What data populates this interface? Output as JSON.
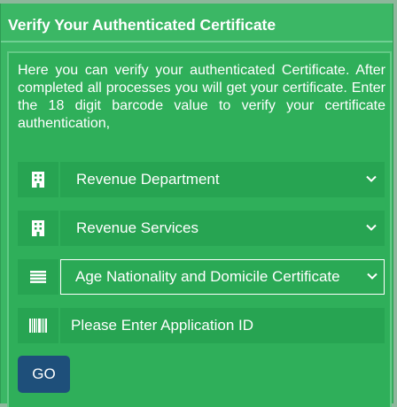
{
  "panel": {
    "title": "Verify Your Authenticated Certificate"
  },
  "intro_text": "Here you can verify your authenticated Certificate. After completed all processes you will get your certificate. Enter the 18 digit barcode value to verify your certificate authentication,",
  "form": {
    "department": {
      "icon": "building-icon",
      "selected": "Revenue Department"
    },
    "service": {
      "icon": "building-icon",
      "selected": "Revenue Services"
    },
    "certificate": {
      "icon": "list-icon",
      "selected": "Age Nationality and Domicile Certificate"
    },
    "application_id": {
      "icon": "barcode-icon",
      "placeholder": "Please Enter Application ID",
      "value": ""
    },
    "go_label": "GO"
  },
  "colors": {
    "panel_green": "#3bb765",
    "field_green": "#27a452",
    "button_blue": "#1e4f7a"
  }
}
